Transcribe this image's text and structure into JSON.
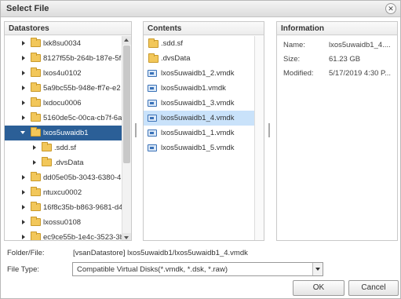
{
  "dialog": {
    "title": "Select File"
  },
  "datastores": {
    "header": "Datastores",
    "items": [
      {
        "label": "lxk8su0034",
        "level": 0,
        "expanded": false,
        "selected": false
      },
      {
        "label": "8127f55b-264b-187e-5f",
        "level": 0,
        "expanded": false,
        "selected": false
      },
      {
        "label": "lxos4u0102",
        "level": 0,
        "expanded": false,
        "selected": false
      },
      {
        "label": "5a9bc55b-948e-ff7e-e2",
        "level": 0,
        "expanded": false,
        "selected": false
      },
      {
        "label": "lxdocu0006",
        "level": 0,
        "expanded": false,
        "selected": false
      },
      {
        "label": "5160de5c-00ca-cb7f-6a",
        "level": 0,
        "expanded": false,
        "selected": false
      },
      {
        "label": "lxos5uwaidb1",
        "level": 0,
        "expanded": true,
        "selected": true
      },
      {
        "label": ".sdd.sf",
        "level": 1,
        "expanded": false,
        "selected": false
      },
      {
        "label": ".dvsData",
        "level": 1,
        "expanded": false,
        "selected": false
      },
      {
        "label": "dd05e05b-3043-6380-4",
        "level": 0,
        "expanded": false,
        "selected": false
      },
      {
        "label": "ntuxcu0002",
        "level": 0,
        "expanded": false,
        "selected": false
      },
      {
        "label": "16f8c35b-b863-9681-d4",
        "level": 0,
        "expanded": false,
        "selected": false
      },
      {
        "label": "lxossu0108",
        "level": 0,
        "expanded": false,
        "selected": false
      },
      {
        "label": "ec9ce55b-1e4c-3523-3b",
        "level": 0,
        "expanded": false,
        "selected": false
      }
    ]
  },
  "contents": {
    "header": "Contents",
    "items": [
      {
        "label": ".sdd.sf",
        "icon": "folder-icon",
        "selected": false
      },
      {
        "label": ".dvsData",
        "icon": "folder-icon",
        "selected": false
      },
      {
        "label": "lxos5uwaidb1_2.vmdk",
        "icon": "vmdk-disk-icon",
        "selected": false
      },
      {
        "label": "lxos5uwaidb1.vmdk",
        "icon": "vmdk-disk-icon",
        "selected": false
      },
      {
        "label": "lxos5uwaidb1_3.vmdk",
        "icon": "vmdk-disk-icon",
        "selected": false
      },
      {
        "label": "lxos5uwaidb1_4.vmdk",
        "icon": "vmdk-disk-icon",
        "selected": true
      },
      {
        "label": "lxos5uwaidb1_1.vmdk",
        "icon": "vmdk-disk-icon",
        "selected": false
      },
      {
        "label": "lxos5uwaidb1_5.vmdk",
        "icon": "vmdk-disk-icon",
        "selected": false
      }
    ]
  },
  "information": {
    "header": "Information",
    "rows": [
      {
        "key": "Name:",
        "value": "lxos5uwaidb1_4...."
      },
      {
        "key": "Size:",
        "value": "61.23 GB"
      },
      {
        "key": "Modified:",
        "value": "5/17/2019 4:30 P..."
      }
    ]
  },
  "footer": {
    "folder_file_label": "Folder/File:",
    "folder_file_value": "[vsanDatastore] lxos5uwaidb1/lxos5uwaidb1_4.vmdk",
    "file_type_label": "File Type:",
    "file_type_value": "Compatible Virtual Disks(*.vmdk, *.dsk, *.raw)"
  },
  "buttons": {
    "ok": "OK",
    "cancel": "Cancel"
  },
  "icons": {
    "close": "close-icon",
    "folder": "folder-icon",
    "disk": "vmdk-disk-icon"
  },
  "colors": {
    "tree_selected": "#2b5f97",
    "list_selected": "#c9e2fa",
    "folder": "#f2c75a"
  }
}
